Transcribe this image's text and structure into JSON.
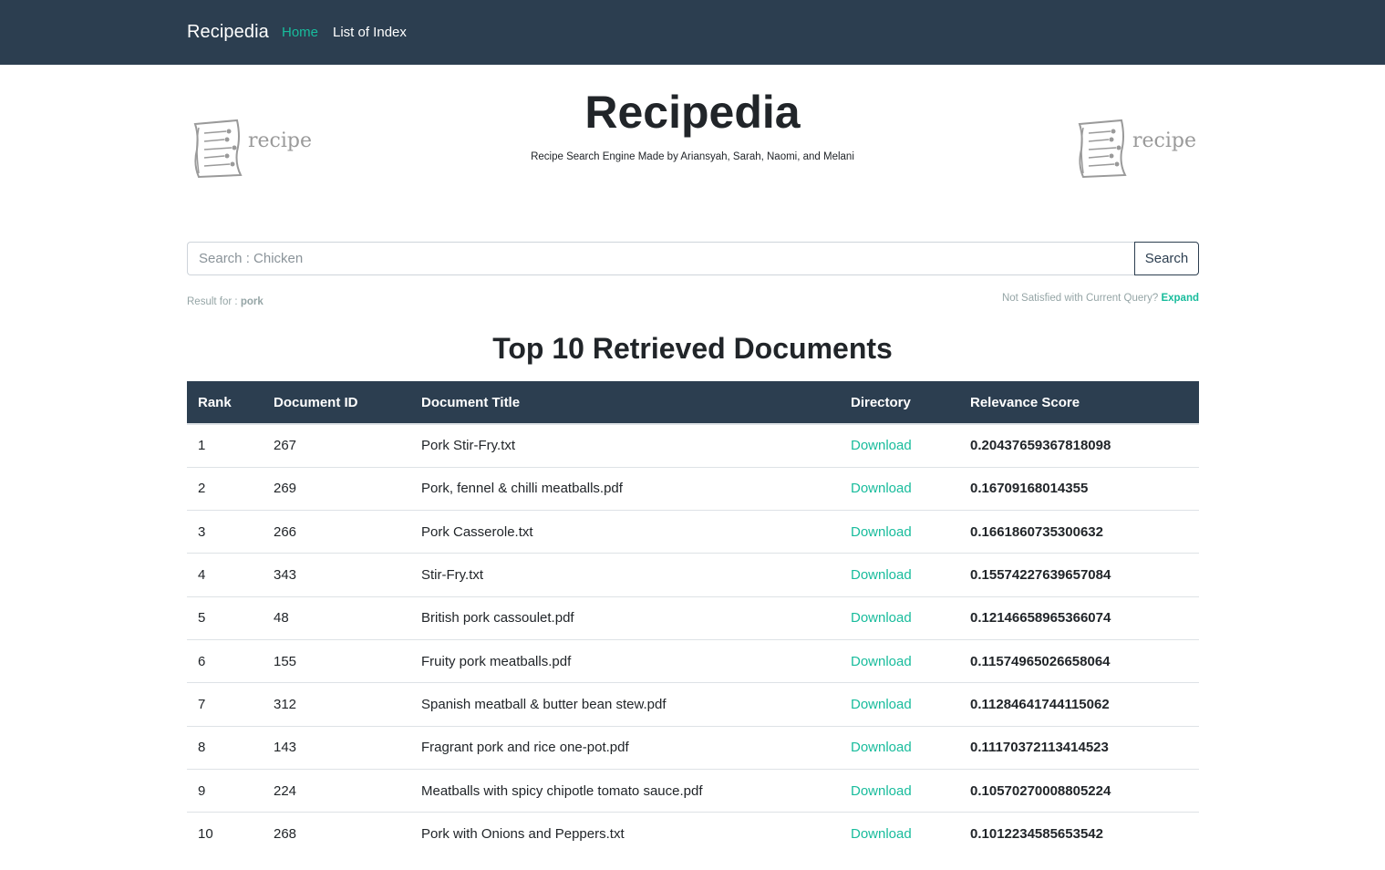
{
  "navbar": {
    "brand": "Recipedia",
    "links": [
      {
        "label": "Home",
        "active": true
      },
      {
        "label": "List of Index",
        "active": false
      }
    ]
  },
  "hero": {
    "title": "Recipedia",
    "subtitle": "Recipe Search Engine Made by Ariansyah, Sarah, Naomi, and Melani",
    "logo_word": "recipe"
  },
  "search": {
    "placeholder": "Search : Chicken",
    "value": "",
    "button_label": "Search"
  },
  "result_info": {
    "prefix": "Result for : ",
    "query": "pork",
    "expand_prompt": "Not Satisfied with Current Query? ",
    "expand_label": "Expand"
  },
  "table": {
    "title": "Top 10 Retrieved Documents",
    "columns": [
      "Rank",
      "Document ID",
      "Document Title",
      "Directory",
      "Relevance Score"
    ],
    "rows": [
      {
        "rank": "1",
        "doc_id": "267",
        "title": "Pork Stir-Fry.txt",
        "directory": "Download",
        "score": "0.20437659367818098"
      },
      {
        "rank": "2",
        "doc_id": "269",
        "title": "Pork, fennel & chilli meatballs.pdf",
        "directory": "Download",
        "score": "0.16709168014355"
      },
      {
        "rank": "3",
        "doc_id": "266",
        "title": "Pork Casserole.txt",
        "directory": "Download",
        "score": "0.1661860735300632"
      },
      {
        "rank": "4",
        "doc_id": "343",
        "title": "Stir-Fry.txt",
        "directory": "Download",
        "score": "0.15574227639657084"
      },
      {
        "rank": "5",
        "doc_id": "48",
        "title": "British pork cassoulet.pdf",
        "directory": "Download",
        "score": "0.12146658965366074"
      },
      {
        "rank": "6",
        "doc_id": "155",
        "title": "Fruity pork meatballs.pdf",
        "directory": "Download",
        "score": "0.11574965026658064"
      },
      {
        "rank": "7",
        "doc_id": "312",
        "title": "Spanish meatball & butter bean stew.pdf",
        "directory": "Download",
        "score": "0.11284641744115062"
      },
      {
        "rank": "8",
        "doc_id": "143",
        "title": "Fragrant pork and rice one-pot.pdf",
        "directory": "Download",
        "score": "0.11170372113414523"
      },
      {
        "rank": "9",
        "doc_id": "224",
        "title": "Meatballs with spicy chipotle tomato sauce.pdf",
        "directory": "Download",
        "score": "0.10570270008805224"
      },
      {
        "rank": "10",
        "doc_id": "268",
        "title": "Pork with Onions and Peppers.txt",
        "directory": "Download",
        "score": "0.1012234585653542"
      }
    ]
  },
  "colors": {
    "navbar_bg": "#2c3e50",
    "accent": "#18bc9c",
    "muted": "#95a5a6"
  }
}
